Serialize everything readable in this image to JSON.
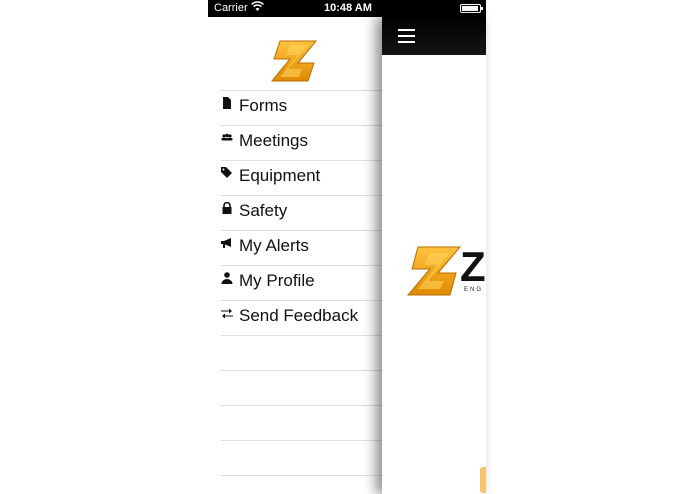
{
  "status": {
    "carrier": "Carrier",
    "time": "10:48 AM"
  },
  "menu": {
    "items": [
      {
        "label": "Forms",
        "icon": "document-icon"
      },
      {
        "label": "Meetings",
        "icon": "group-icon"
      },
      {
        "label": "Equipment",
        "icon": "tag-icon"
      },
      {
        "label": "Safety",
        "icon": "lock-icon"
      },
      {
        "label": "My Alerts",
        "icon": "megaphone-icon"
      },
      {
        "label": "My Profile",
        "icon": "user-icon"
      },
      {
        "label": "Send Feedback",
        "icon": "exchange-icon"
      }
    ]
  },
  "main": {
    "brand_letter": "Z",
    "brand_sub": "ENG"
  },
  "colors": {
    "brand_orange": "#f5a623",
    "nav_bar": "#111111"
  }
}
